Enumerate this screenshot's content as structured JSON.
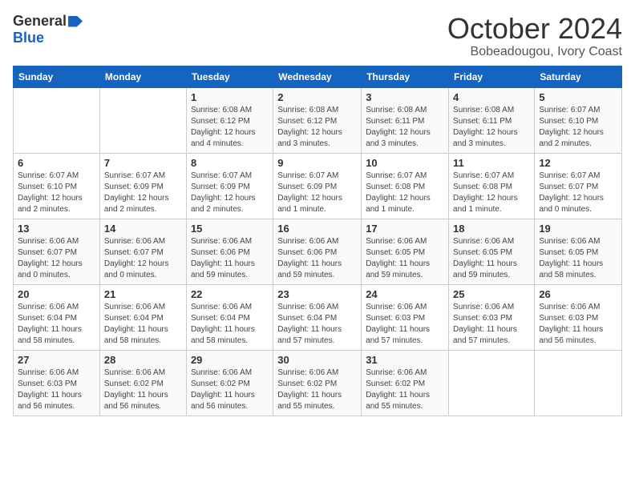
{
  "logo": {
    "general": "General",
    "blue": "Blue"
  },
  "title": "October 2024",
  "location": "Bobeadougou, Ivory Coast",
  "headers": [
    "Sunday",
    "Monday",
    "Tuesday",
    "Wednesday",
    "Thursday",
    "Friday",
    "Saturday"
  ],
  "weeks": [
    [
      {
        "day": "",
        "info": ""
      },
      {
        "day": "",
        "info": ""
      },
      {
        "day": "1",
        "info": "Sunrise: 6:08 AM\nSunset: 6:12 PM\nDaylight: 12 hours and 4 minutes."
      },
      {
        "day": "2",
        "info": "Sunrise: 6:08 AM\nSunset: 6:12 PM\nDaylight: 12 hours and 3 minutes."
      },
      {
        "day": "3",
        "info": "Sunrise: 6:08 AM\nSunset: 6:11 PM\nDaylight: 12 hours and 3 minutes."
      },
      {
        "day": "4",
        "info": "Sunrise: 6:08 AM\nSunset: 6:11 PM\nDaylight: 12 hours and 3 minutes."
      },
      {
        "day": "5",
        "info": "Sunrise: 6:07 AM\nSunset: 6:10 PM\nDaylight: 12 hours and 2 minutes."
      }
    ],
    [
      {
        "day": "6",
        "info": "Sunrise: 6:07 AM\nSunset: 6:10 PM\nDaylight: 12 hours and 2 minutes."
      },
      {
        "day": "7",
        "info": "Sunrise: 6:07 AM\nSunset: 6:09 PM\nDaylight: 12 hours and 2 minutes."
      },
      {
        "day": "8",
        "info": "Sunrise: 6:07 AM\nSunset: 6:09 PM\nDaylight: 12 hours and 2 minutes."
      },
      {
        "day": "9",
        "info": "Sunrise: 6:07 AM\nSunset: 6:09 PM\nDaylight: 12 hours and 1 minute."
      },
      {
        "day": "10",
        "info": "Sunrise: 6:07 AM\nSunset: 6:08 PM\nDaylight: 12 hours and 1 minute."
      },
      {
        "day": "11",
        "info": "Sunrise: 6:07 AM\nSunset: 6:08 PM\nDaylight: 12 hours and 1 minute."
      },
      {
        "day": "12",
        "info": "Sunrise: 6:07 AM\nSunset: 6:07 PM\nDaylight: 12 hours and 0 minutes."
      }
    ],
    [
      {
        "day": "13",
        "info": "Sunrise: 6:06 AM\nSunset: 6:07 PM\nDaylight: 12 hours and 0 minutes."
      },
      {
        "day": "14",
        "info": "Sunrise: 6:06 AM\nSunset: 6:07 PM\nDaylight: 12 hours and 0 minutes."
      },
      {
        "day": "15",
        "info": "Sunrise: 6:06 AM\nSunset: 6:06 PM\nDaylight: 11 hours and 59 minutes."
      },
      {
        "day": "16",
        "info": "Sunrise: 6:06 AM\nSunset: 6:06 PM\nDaylight: 11 hours and 59 minutes."
      },
      {
        "day": "17",
        "info": "Sunrise: 6:06 AM\nSunset: 6:05 PM\nDaylight: 11 hours and 59 minutes."
      },
      {
        "day": "18",
        "info": "Sunrise: 6:06 AM\nSunset: 6:05 PM\nDaylight: 11 hours and 59 minutes."
      },
      {
        "day": "19",
        "info": "Sunrise: 6:06 AM\nSunset: 6:05 PM\nDaylight: 11 hours and 58 minutes."
      }
    ],
    [
      {
        "day": "20",
        "info": "Sunrise: 6:06 AM\nSunset: 6:04 PM\nDaylight: 11 hours and 58 minutes."
      },
      {
        "day": "21",
        "info": "Sunrise: 6:06 AM\nSunset: 6:04 PM\nDaylight: 11 hours and 58 minutes."
      },
      {
        "day": "22",
        "info": "Sunrise: 6:06 AM\nSunset: 6:04 PM\nDaylight: 11 hours and 58 minutes."
      },
      {
        "day": "23",
        "info": "Sunrise: 6:06 AM\nSunset: 6:04 PM\nDaylight: 11 hours and 57 minutes."
      },
      {
        "day": "24",
        "info": "Sunrise: 6:06 AM\nSunset: 6:03 PM\nDaylight: 11 hours and 57 minutes."
      },
      {
        "day": "25",
        "info": "Sunrise: 6:06 AM\nSunset: 6:03 PM\nDaylight: 11 hours and 57 minutes."
      },
      {
        "day": "26",
        "info": "Sunrise: 6:06 AM\nSunset: 6:03 PM\nDaylight: 11 hours and 56 minutes."
      }
    ],
    [
      {
        "day": "27",
        "info": "Sunrise: 6:06 AM\nSunset: 6:03 PM\nDaylight: 11 hours and 56 minutes."
      },
      {
        "day": "28",
        "info": "Sunrise: 6:06 AM\nSunset: 6:02 PM\nDaylight: 11 hours and 56 minutes."
      },
      {
        "day": "29",
        "info": "Sunrise: 6:06 AM\nSunset: 6:02 PM\nDaylight: 11 hours and 56 minutes."
      },
      {
        "day": "30",
        "info": "Sunrise: 6:06 AM\nSunset: 6:02 PM\nDaylight: 11 hours and 55 minutes."
      },
      {
        "day": "31",
        "info": "Sunrise: 6:06 AM\nSunset: 6:02 PM\nDaylight: 11 hours and 55 minutes."
      },
      {
        "day": "",
        "info": ""
      },
      {
        "day": "",
        "info": ""
      }
    ]
  ]
}
